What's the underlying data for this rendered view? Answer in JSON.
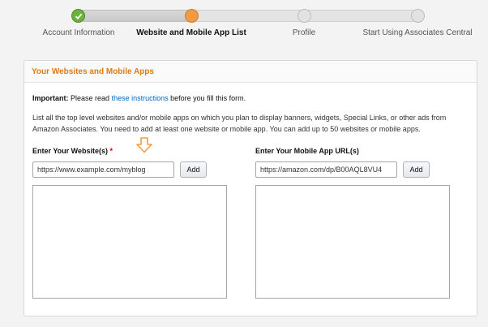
{
  "steps": [
    {
      "label": "Account Information",
      "state": "done"
    },
    {
      "label": "Website and Mobile App List",
      "state": "current"
    },
    {
      "label": "Profile",
      "state": "pending"
    },
    {
      "label": "Start Using Associates Central",
      "state": "pending"
    }
  ],
  "card": {
    "title": "Your Websites and Mobile Apps",
    "important_label": "Important:",
    "important_pre": "Please read",
    "important_link": "these instructions",
    "important_post": "before you fill this form.",
    "description": "List all the top level websites and/or mobile apps on which you plan to display banners, widgets, Special Links, or other ads from Amazon Associates. You need to add at least one website or mobile app. You can add up to 50 websites or mobile apps."
  },
  "websites": {
    "label": "Enter Your Website(s)",
    "required_mark": "*",
    "input_value": "https://www.example.com/myblog",
    "add_label": "Add"
  },
  "apps": {
    "label": "Enter Your Mobile App URL(s)",
    "input_value": "https://amazon.com/dp/B00AQL8VU4",
    "add_label": "Add"
  },
  "colors": {
    "accent": "#e47911",
    "step_done": "#6cb33e",
    "step_current": "#f39b40",
    "link": "#0066c0"
  },
  "icons": {
    "step_done": "check-icon",
    "pointer": "arrow-down-icon"
  }
}
